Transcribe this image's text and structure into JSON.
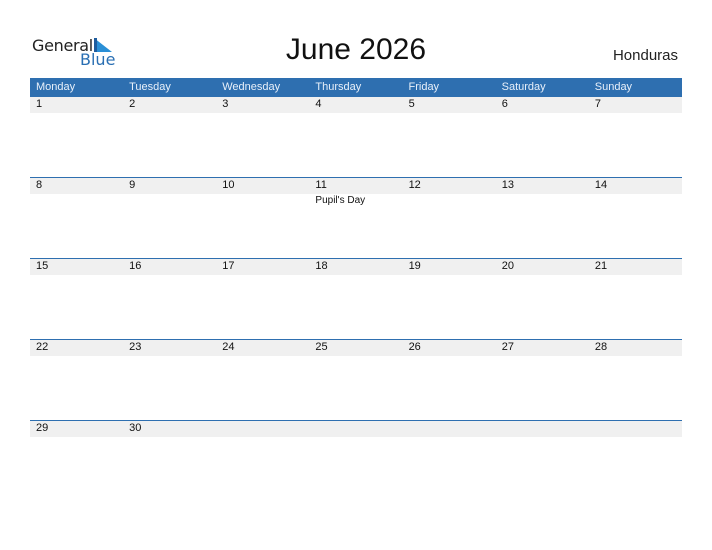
{
  "logo": {
    "text_general": "General",
    "text_blue": "Blue"
  },
  "title": "June 2026",
  "country": "Honduras",
  "colors": {
    "accent": "#2e6fb0",
    "date_strip": "#f0f0f0"
  },
  "days": [
    "Monday",
    "Tuesday",
    "Wednesday",
    "Thursday",
    "Friday",
    "Saturday",
    "Sunday"
  ],
  "weeks": [
    {
      "cells": [
        {
          "date": "1",
          "event": ""
        },
        {
          "date": "2",
          "event": ""
        },
        {
          "date": "3",
          "event": ""
        },
        {
          "date": "4",
          "event": ""
        },
        {
          "date": "5",
          "event": ""
        },
        {
          "date": "6",
          "event": ""
        },
        {
          "date": "7",
          "event": ""
        }
      ]
    },
    {
      "cells": [
        {
          "date": "8",
          "event": ""
        },
        {
          "date": "9",
          "event": ""
        },
        {
          "date": "10",
          "event": ""
        },
        {
          "date": "11",
          "event": "Pupil's Day"
        },
        {
          "date": "12",
          "event": ""
        },
        {
          "date": "13",
          "event": ""
        },
        {
          "date": "14",
          "event": ""
        }
      ]
    },
    {
      "cells": [
        {
          "date": "15",
          "event": ""
        },
        {
          "date": "16",
          "event": ""
        },
        {
          "date": "17",
          "event": ""
        },
        {
          "date": "18",
          "event": ""
        },
        {
          "date": "19",
          "event": ""
        },
        {
          "date": "20",
          "event": ""
        },
        {
          "date": "21",
          "event": ""
        }
      ]
    },
    {
      "cells": [
        {
          "date": "22",
          "event": ""
        },
        {
          "date": "23",
          "event": ""
        },
        {
          "date": "24",
          "event": ""
        },
        {
          "date": "25",
          "event": ""
        },
        {
          "date": "26",
          "event": ""
        },
        {
          "date": "27",
          "event": ""
        },
        {
          "date": "28",
          "event": ""
        }
      ]
    },
    {
      "cells": [
        {
          "date": "29",
          "event": ""
        },
        {
          "date": "30",
          "event": ""
        },
        {
          "date": "",
          "event": ""
        },
        {
          "date": "",
          "event": ""
        },
        {
          "date": "",
          "event": ""
        },
        {
          "date": "",
          "event": ""
        },
        {
          "date": "",
          "event": ""
        }
      ]
    }
  ]
}
